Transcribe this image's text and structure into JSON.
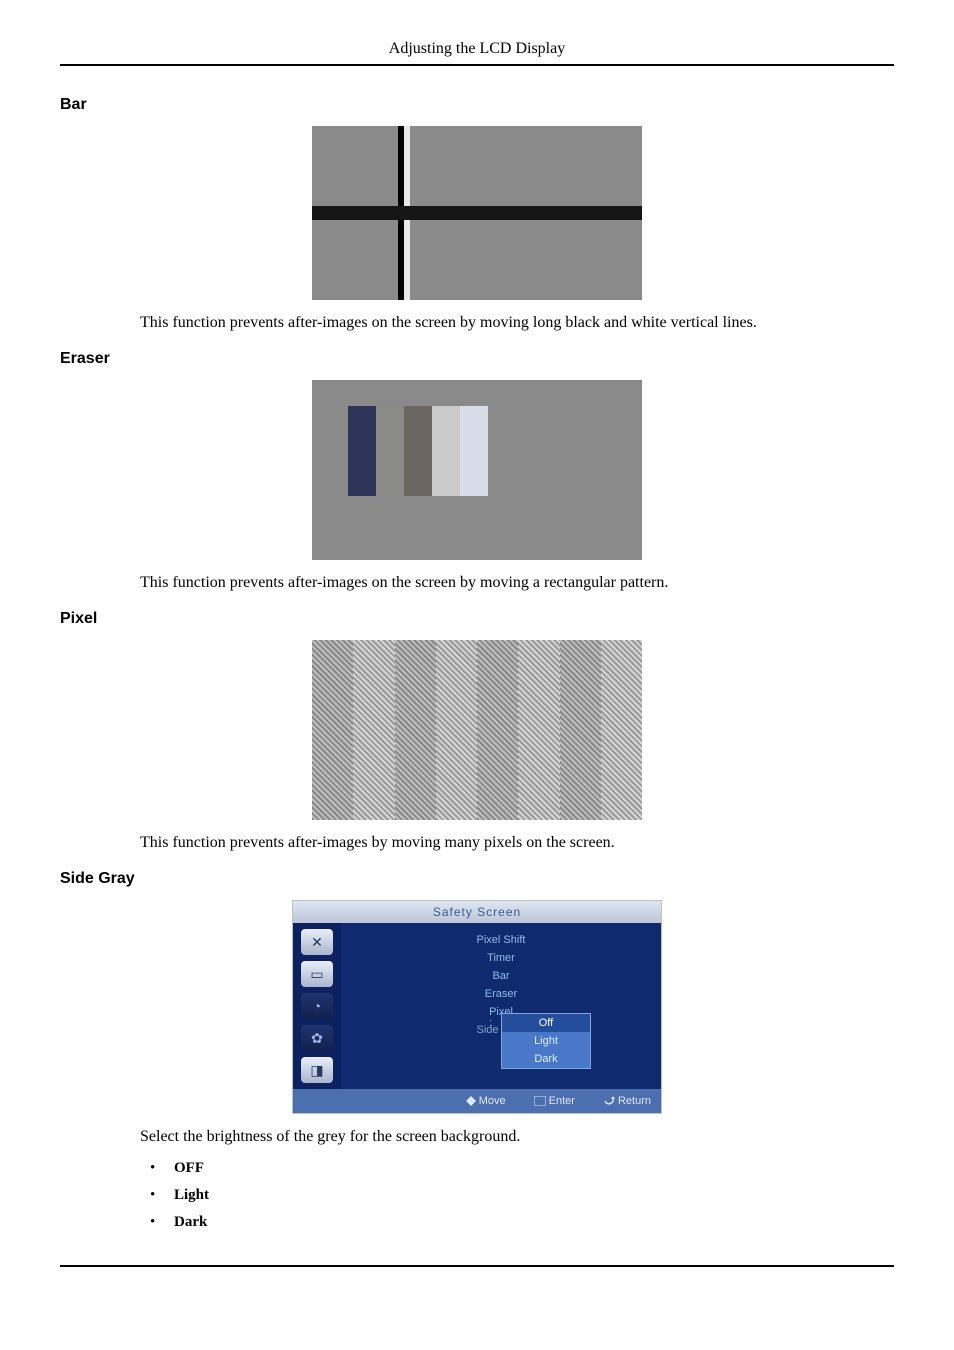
{
  "header": {
    "title": "Adjusting the LCD Display"
  },
  "sections": {
    "bar": {
      "heading": "Bar",
      "text": "This function prevents after-images on the screen by moving long black and white vertical lines."
    },
    "eraser": {
      "heading": "Eraser",
      "text": "This function prevents after-images on the screen by moving a rectangular pattern."
    },
    "pixel": {
      "heading": "Pixel",
      "text": "This function prevents after-images by moving many pixels on the screen."
    },
    "sidegray": {
      "heading": "Side Gray",
      "text": "Select the brightness of the grey for the screen background.",
      "bullets": [
        "OFF",
        "Light",
        "Dark"
      ]
    }
  },
  "osd": {
    "title": "Safety Screen",
    "menu": [
      "Pixel Shift",
      "Timer",
      "Bar",
      "Eraser",
      "Pixel",
      "Side Gray"
    ],
    "options": [
      "Off",
      "Light",
      "Dark"
    ],
    "footer": {
      "move": "Move",
      "enter": "Enter",
      "return": "Return"
    }
  }
}
